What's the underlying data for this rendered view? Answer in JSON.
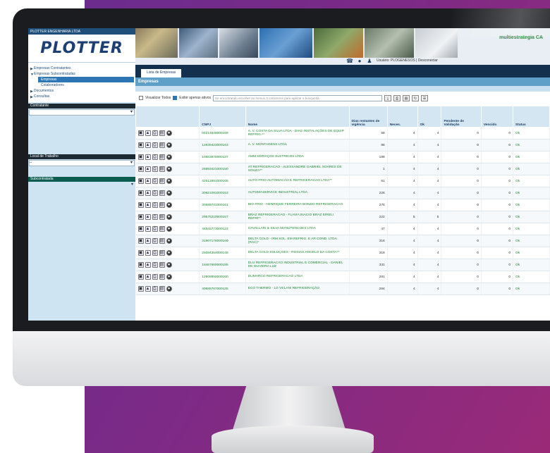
{
  "app": {
    "company_line": "PLOTTER ENGENHARIA LTDA",
    "logo": "PLOTTER",
    "partner_logo": "multiestrategia CA",
    "user_text": "Usuário: PLOGENESOS | Desconectar"
  },
  "sidebar": {
    "items": [
      {
        "label": "Empresas Contratantes",
        "level": 0
      },
      {
        "label": "Empresas Subcontratadas",
        "level": 0
      },
      {
        "label": "Empresas",
        "level": 1,
        "active": true
      },
      {
        "label": "Colaboradores",
        "level": 1
      },
      {
        "label": "Documentos",
        "level": 0
      },
      {
        "label": "Consultas",
        "level": 0
      }
    ],
    "sections": [
      "Contratante",
      "Local de Trabalho",
      "Subcontratada"
    ],
    "select_values": [
      "",
      "--",
      ""
    ]
  },
  "tabs": [
    "Lista de Empresas"
  ],
  "panel_title": "Empresas",
  "filters": {
    "show_all": "Visualizar Todos",
    "active_only": "Exibir apenas ativos",
    "search_placeholder": "Se encontrando escolher ao menos 3 caracteres para agilizar a busqueda"
  },
  "table": {
    "headers": [
      "",
      "CNPJ",
      "Nome",
      "Dias restantes de vigência",
      "Neces.",
      "Ok",
      "Pendente de Validação",
      "Vencido",
      "Status"
    ],
    "rows": [
      {
        "cnpj": "04214848000159",
        "name": "A. V. COSTA DA SILVA LTDA - DIAS INSTALAÇÕES DE EQUIP. REFRIG.**",
        "dias": "68",
        "neces": "4",
        "ok": "4",
        "pend": "0",
        "venc": "0",
        "status": "Ok"
      },
      {
        "cnpj": "12839423000163",
        "name": "A. V. MONTAGENS LTDA",
        "dias": "86",
        "neces": "4",
        "ok": "4",
        "pend": "0",
        "venc": "0",
        "status": "Ok"
      },
      {
        "cnpj": "10583878000137",
        "name": "AMM SERVIÇOS ELETRICOS LTDA",
        "dias": "188",
        "neces": "4",
        "ok": "4",
        "pend": "0",
        "venc": "0",
        "status": "Ok"
      },
      {
        "cnpj": "26893421000150",
        "name": "AT REFRIGERACAO - ALESSANDRE GABRIEL SOARES DE SOUZA**",
        "dias": "1",
        "neces": "4",
        "ok": "4",
        "pend": "0",
        "venc": "0",
        "status": "Ok"
      },
      {
        "cnpj": "42512681000105",
        "name": "AUTO FRIO AUTOMACAO E REFRIGERACAO LTDA**",
        "dias": "61",
        "neces": "4",
        "ok": "4",
        "pend": "0",
        "venc": "0",
        "status": "Ok"
      },
      {
        "cnpj": "30621081000153",
        "name": "AUTOMASERVICE INDUSTRIAL LTDA",
        "dias": "226",
        "neces": "4",
        "ok": "4",
        "pend": "0",
        "venc": "0",
        "status": "Ok"
      },
      {
        "cnpj": "30589741000161",
        "name": "BIO FRIO - HENRIQUE FERREIRA BONDO REFRIGERACAO",
        "dias": "276",
        "neces": "4",
        "ok": "4",
        "pend": "0",
        "venc": "0",
        "status": "Ok"
      },
      {
        "cnpj": "29575210000157",
        "name": "BRAZ REFRIGERACAO - FLAVIA INACIO BRAZ EIRELI REFRI**",
        "dias": "222",
        "neces": "5",
        "ok": "5",
        "pend": "0",
        "venc": "0",
        "status": "Ok"
      },
      {
        "cnpj": "44545773000122",
        "name": "CAVALLARI & SILVA MANUTENCOES LTDA",
        "dias": "47",
        "neces": "4",
        "ok": "4",
        "pend": "0",
        "venc": "0",
        "status": "Ok"
      },
      {
        "cnpj": "31907178000160",
        "name": "DELTA COLD - IRM SOL. EM REFRIG. E AR COND. LTDA (RAC)*",
        "dias": "316",
        "neces": "4",
        "ok": "4",
        "pend": "0",
        "venc": "0",
        "status": "Ok"
      },
      {
        "cnpj": "25084354000148",
        "name": "DELTA COLD SOLUÇOES - ROSIAS ANGELO DA COSTA**",
        "dias": "318",
        "neces": "4",
        "ok": "4",
        "pend": "0",
        "venc": "0",
        "status": "Ok"
      },
      {
        "cnpj": "18467660000185",
        "name": "DLU REFRIGERACAO INDUSTRIAL E COMERCIAL - DANIEL DE OLIVEIRA LUZ",
        "dias": "331",
        "neces": "4",
        "ok": "4",
        "pend": "0",
        "venc": "0",
        "status": "Ok"
      },
      {
        "cnpj": "12908958000160",
        "name": "DUMARCO REFRIGERACAO LTDA",
        "dias": "281",
        "neces": "4",
        "ok": "4",
        "pend": "0",
        "venc": "0",
        "status": "Ok"
      },
      {
        "cnpj": "40685767000135",
        "name": "ECO THERMO - LG VELANI REFRIGERAÇÃO",
        "dias": "284",
        "neces": "4",
        "ok": "4",
        "pend": "0",
        "venc": "0",
        "status": "Ok"
      }
    ]
  }
}
